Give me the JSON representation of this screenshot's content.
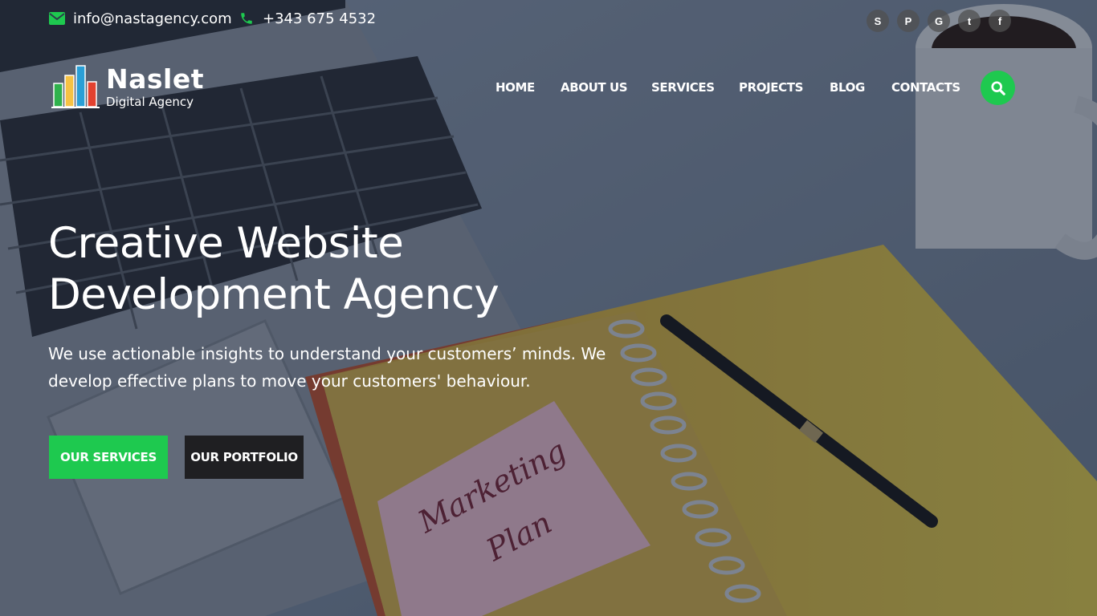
{
  "topbar": {
    "email": "info@nastagency.com",
    "phone": "+343 675 4532",
    "socials": [
      {
        "icon": "skype-icon",
        "glyph": "S"
      },
      {
        "icon": "pinterest-icon",
        "glyph": "P"
      },
      {
        "icon": "google-icon",
        "glyph": "G"
      },
      {
        "icon": "twitter-icon",
        "glyph": "t"
      },
      {
        "icon": "facebook-icon",
        "glyph": "f"
      }
    ]
  },
  "brand": {
    "name": "Naslet",
    "tagline": "Digital Agency",
    "logo_colors": [
      "#2fb24c",
      "#f6c244",
      "#2a9fd6",
      "#e3412f"
    ]
  },
  "nav": {
    "items": [
      {
        "label": "HOME"
      },
      {
        "label": "ABOUT US"
      },
      {
        "label": "SERVICES"
      },
      {
        "label": "PROJECTS"
      },
      {
        "label": "BLOG"
      },
      {
        "label": "CONTACTS"
      }
    ],
    "search_icon": "search-icon"
  },
  "hero": {
    "headline_line1": "Creative Website",
    "headline_line2": "Development Agency",
    "subtitle": "We use actionable insights to understand your customers’ minds. We develop effective plans to move your customers' behaviour.",
    "primary_button": "OUR SERVICES",
    "secondary_button": "OUR PORTFOLIO",
    "sticky_note_line1": "Marketing",
    "sticky_note_line2": "Plan"
  },
  "colors": {
    "accent": "#1ec94f",
    "dark_button": "#1f1f22"
  }
}
